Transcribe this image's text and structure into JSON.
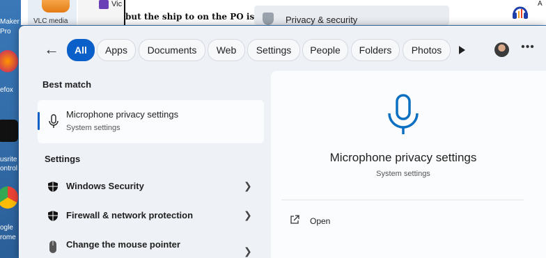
{
  "desktop": {
    "left_icons": [
      {
        "label": "Maker",
        "sub": "Pro"
      },
      {
        "label": "efox"
      },
      {
        "label": "usrite",
        "sub": "ontrol"
      },
      {
        "label": "ogle",
        "sub": "rome"
      }
    ],
    "vlc_label": "VLC media",
    "vid_text": "Vic",
    "doc_text": "but the ship to on the PO is",
    "settings_chip": "Privacy & security",
    "right_text": "A"
  },
  "search": {
    "tabs": [
      "All",
      "Apps",
      "Documents",
      "Web",
      "Settings",
      "People",
      "Folders",
      "Photos"
    ],
    "active_tab": "All",
    "best_match_heading": "Best match",
    "best_match": {
      "title": "Microphone privacy settings",
      "subtitle": "System settings"
    },
    "settings_heading": "Settings",
    "settings_results": [
      {
        "label": "Windows Security",
        "icon": "shield-icon"
      },
      {
        "label": "Firewall & network protection",
        "icon": "shield-icon"
      },
      {
        "label": "Change the mouse pointer",
        "icon": "mouse-icon"
      }
    ],
    "detail": {
      "title": "Microphone privacy settings",
      "subtitle": "System settings",
      "actions": [
        {
          "label": "Open",
          "icon": "open-external-icon"
        }
      ]
    }
  },
  "colors": {
    "accent": "#0b5fc9",
    "mic": "#0b6fc2"
  }
}
